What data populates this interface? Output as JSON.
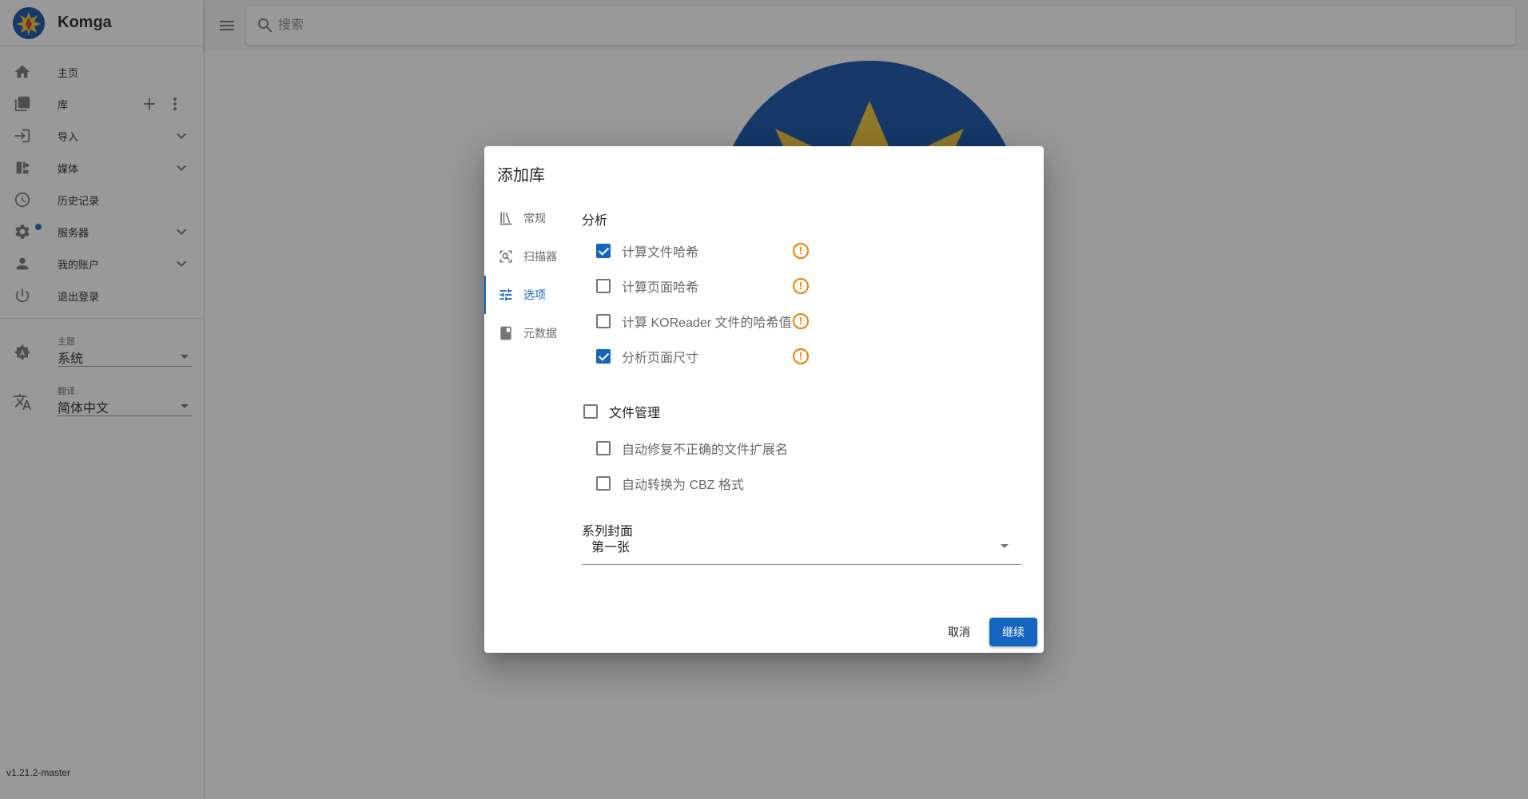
{
  "app": {
    "name": "Komga",
    "version": "v1.21.2-master"
  },
  "sidebar": {
    "items": [
      {
        "label": "主页",
        "icon": "home-icon"
      },
      {
        "label": "库",
        "icon": "library-icon"
      },
      {
        "label": "导入",
        "icon": "import-icon"
      },
      {
        "label": "媒体",
        "icon": "media-management-icon"
      },
      {
        "label": "历史记录",
        "icon": "history-icon"
      },
      {
        "label": "服务器",
        "icon": "gear-icon"
      },
      {
        "label": "我的账户",
        "icon": "account-icon"
      },
      {
        "label": "退出登录",
        "icon": "power-icon"
      }
    ],
    "theme": {
      "label": "主题",
      "value": "系统"
    },
    "language": {
      "label": "翻译",
      "value": "简体中文"
    }
  },
  "search": {
    "placeholder": "搜索"
  },
  "dialog": {
    "title": "添加库",
    "tabs": [
      {
        "label": "常规",
        "icon": "bookshelf-icon"
      },
      {
        "label": "扫描器",
        "icon": "scanner-icon"
      },
      {
        "label": "选项",
        "icon": "tune-icon",
        "active": true
      },
      {
        "label": "元数据",
        "icon": "metadata-icon"
      }
    ],
    "analysis": {
      "title": "分析",
      "options": [
        {
          "label": "计算文件哈希",
          "checked": true
        },
        {
          "label": "计算页面哈希",
          "checked": false
        },
        {
          "label": "计算 KOReader 文件的哈希值",
          "checked": false
        },
        {
          "label": "分析页面尺寸",
          "checked": true
        }
      ]
    },
    "file_management": {
      "label": "文件管理",
      "checked": false,
      "options": [
        {
          "label": "自动修复不正确的文件扩展名",
          "checked": false
        },
        {
          "label": "自动转换为 CBZ 格式",
          "checked": false
        }
      ]
    },
    "series_cover": {
      "label": "系列封面",
      "value": "第一张"
    },
    "cancel_label": "取消",
    "continue_label": "继续"
  },
  "colors": {
    "accent": "#1565c0",
    "warning": "#f57c00",
    "logo_blue": "#0d4ea6"
  }
}
